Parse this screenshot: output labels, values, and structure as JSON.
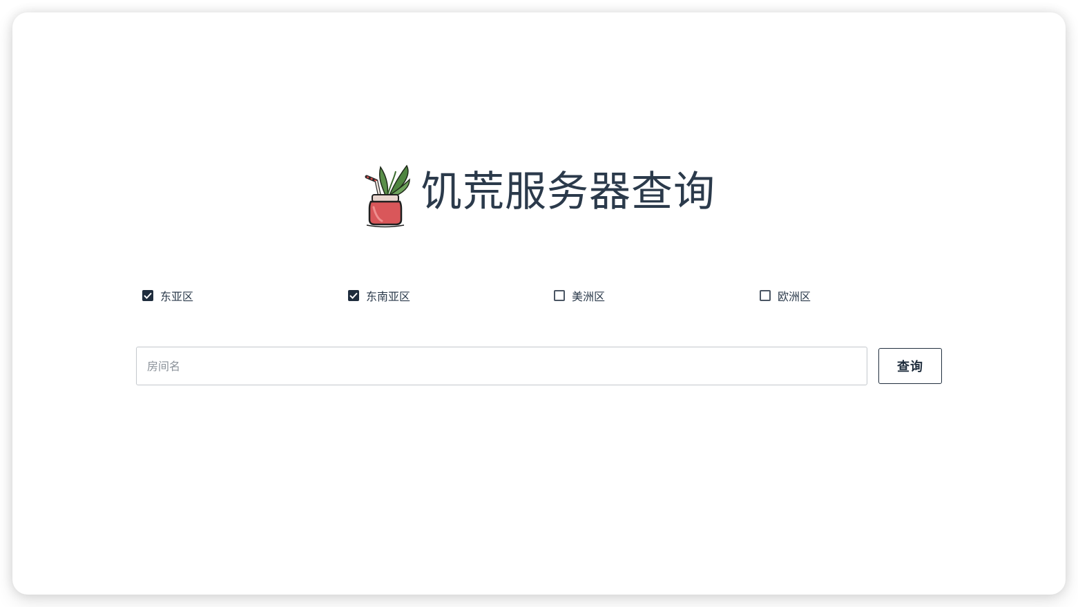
{
  "app": {
    "title": "饥荒服务器查询",
    "logo_icon": "beverage-jar-icon"
  },
  "regions": [
    {
      "label": "东亚区",
      "checked": true
    },
    {
      "label": "东南亚区",
      "checked": true
    },
    {
      "label": "美洲区",
      "checked": false
    },
    {
      "label": "欧洲区",
      "checked": false
    }
  ],
  "search": {
    "placeholder": "房间名",
    "value": "",
    "button_label": "查询"
  },
  "colors": {
    "text": "#2b3a4b",
    "accent": "#1f2d3d",
    "border": "#c3c7cc"
  }
}
